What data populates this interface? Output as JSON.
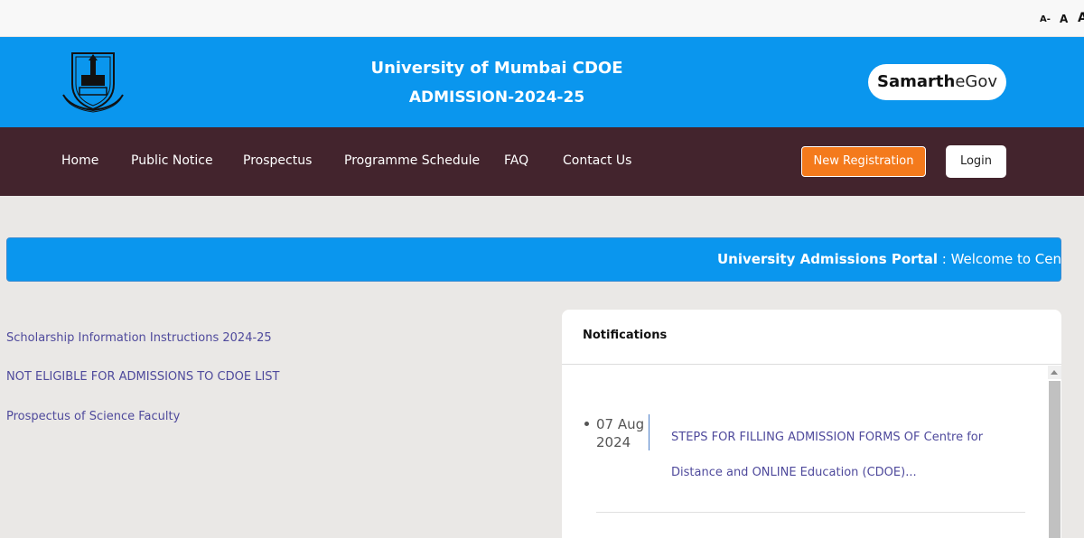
{
  "accessibility": {
    "font_small": "A-",
    "font_normal": "A",
    "font_large": "A"
  },
  "header": {
    "title": "University of Mumbai CDOE",
    "subtitle": "ADMISSION-2024-25",
    "brand_part1": "Samarth",
    "brand_part2": "eGov"
  },
  "nav": {
    "items": [
      {
        "label": "Home"
      },
      {
        "label": "Public Notice"
      },
      {
        "label": "Prospectus"
      },
      {
        "label": "Programme Schedule"
      },
      {
        "label": "FAQ"
      },
      {
        "label": "Contact Us"
      }
    ],
    "new_registration": "New Registration",
    "login": "Login"
  },
  "marquee": {
    "bold": "University Admissions Portal",
    "text": " : Welcome to Centre for D"
  },
  "links": [
    {
      "label": "Scholarship Information Instructions 2024-25"
    },
    {
      "label": "NOT ELIGIBLE FOR ADMISSIONS TO CDOE LIST"
    },
    {
      "label": "Prospectus of Science Faculty"
    }
  ],
  "notifications": {
    "title": "Notifications",
    "items": [
      {
        "date_day": "07 Aug",
        "date_year": "2024",
        "text": "STEPS FOR FILLING ADMISSION FORMS OF Centre for Distance and ONLINE Education (CDOE)..."
      }
    ]
  },
  "colors": {
    "header_blue": "#0a96ee",
    "nav_maroon": "#43242d",
    "cta_orange": "#f47a1c",
    "link_purple": "#4f4a9c"
  }
}
